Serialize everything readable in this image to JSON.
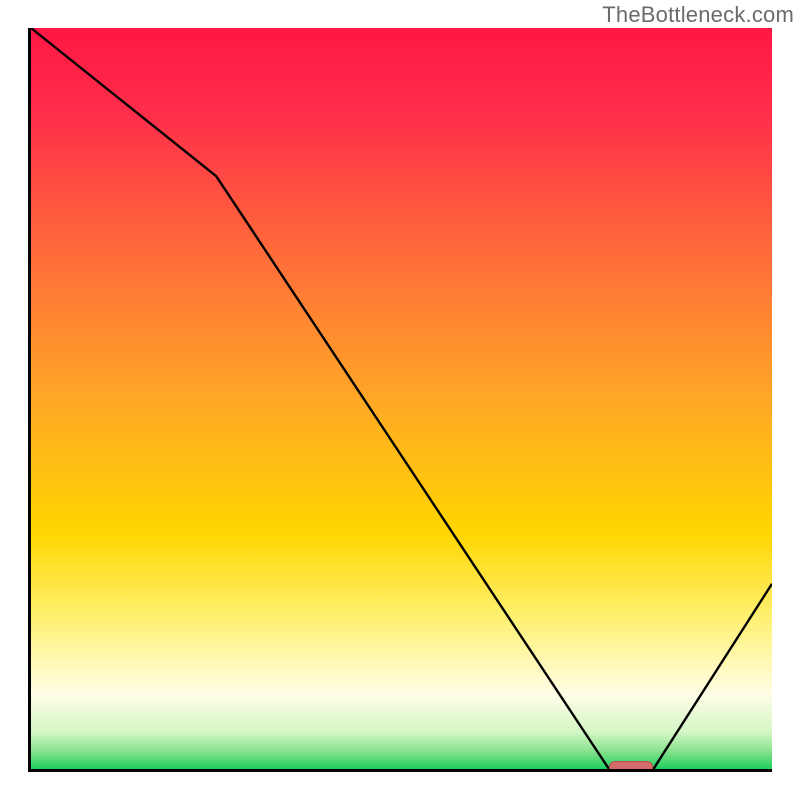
{
  "watermark": "TheBottleneck.com",
  "chart_data": {
    "type": "line",
    "title": "",
    "xlabel": "",
    "ylabel": "",
    "xlim": [
      0,
      100
    ],
    "ylim": [
      0,
      100
    ],
    "x": [
      0,
      25,
      78,
      84,
      100
    ],
    "values": [
      100,
      80,
      0,
      0,
      25
    ],
    "optimal_range": {
      "start": 78,
      "end": 84,
      "y": 0
    },
    "gradient_stops": [
      {
        "pos": 0,
        "color": "#ff1744"
      },
      {
        "pos": 0.12,
        "color": "#ff2f4a"
      },
      {
        "pos": 0.3,
        "color": "#ff6a3a"
      },
      {
        "pos": 0.5,
        "color": "#ffa726"
      },
      {
        "pos": 0.68,
        "color": "#ffd600"
      },
      {
        "pos": 0.8,
        "color": "#fff176"
      },
      {
        "pos": 0.9,
        "color": "#fffde7"
      },
      {
        "pos": 0.95,
        "color": "#d4f7c5"
      },
      {
        "pos": 0.975,
        "color": "#8be28f"
      },
      {
        "pos": 1,
        "color": "#1ecf5e"
      }
    ],
    "curve_color": "#000000",
    "optimal_color": "#d46a6a",
    "optimal_outline": "#b45050"
  }
}
